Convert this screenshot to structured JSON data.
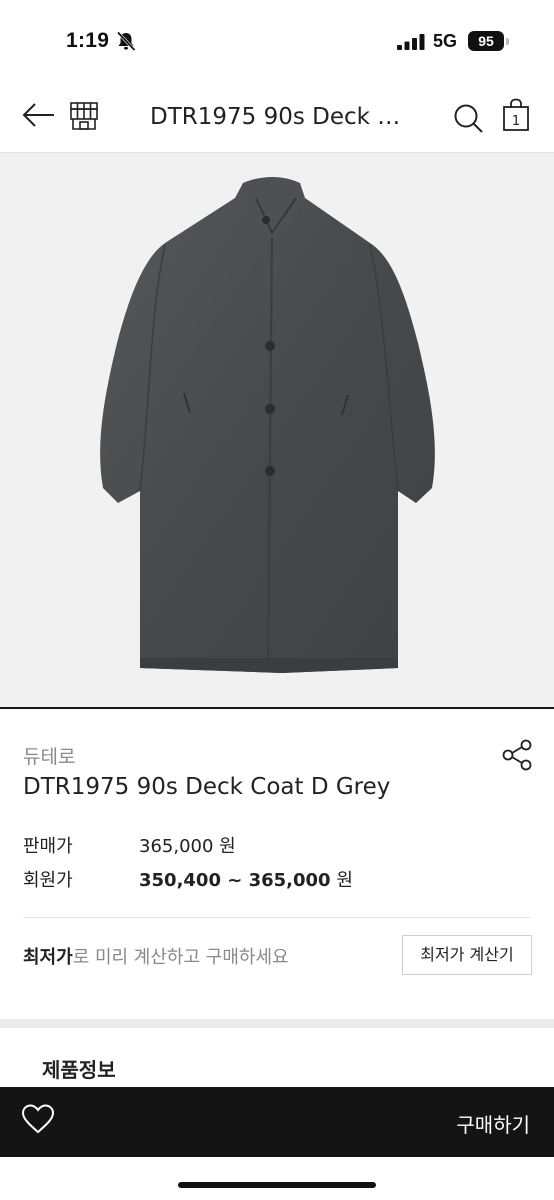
{
  "status_bar": {
    "time": "1:19",
    "network": "5G",
    "battery": "95"
  },
  "nav": {
    "title": "DTR1975 90s Deck Coat D Grey",
    "icons": [
      "back-arrow-icon",
      "store-icon",
      "search-icon",
      "shopping-bag-icon"
    ],
    "cart_count": "1"
  },
  "product": {
    "brand": "듀테로",
    "name": "DTR1975 90s Deck Coat D Grey",
    "sale_price_label": "판매가",
    "sale_price": "365,000",
    "member_price_label": "회원가",
    "member_price": "350,400 ~ 365,000",
    "currency": "원",
    "image_desc_colors": {
      "background": "#f1f1f1",
      "coat": "#4a4d4f"
    }
  },
  "lowest_price": {
    "highlight": "최저가",
    "rest": "로 미리 계산하고 구매하세요",
    "button_label": "최저가 계산기"
  },
  "section": {
    "title": "제품정보"
  },
  "bottom_bar": {
    "buy_label": "구매하기"
  },
  "colors": {
    "accent_dark": "#141414",
    "muted_text": "#8a8a8a"
  }
}
